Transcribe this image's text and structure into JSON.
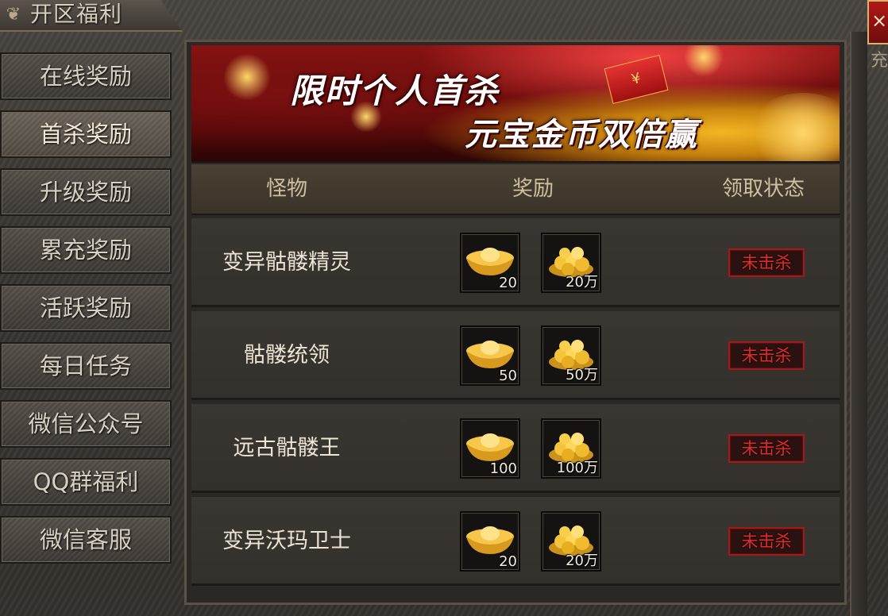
{
  "window": {
    "title": "开区福利",
    "close_label": "×",
    "right_edge_text": "充"
  },
  "sidebar": {
    "items": [
      {
        "label": "在线奖励",
        "active": false
      },
      {
        "label": "首杀奖励",
        "active": true
      },
      {
        "label": "升级奖励",
        "active": false
      },
      {
        "label": "累充奖励",
        "active": false
      },
      {
        "label": "活跃奖励",
        "active": false
      },
      {
        "label": "每日任务",
        "active": false
      },
      {
        "label": "微信公众号",
        "active": false
      },
      {
        "label": "QQ群福利",
        "active": false
      },
      {
        "label": "微信客服",
        "active": false
      }
    ]
  },
  "banner": {
    "line1": "限时个人首杀",
    "line2": "元宝金币双倍赢",
    "redpacket_symbol": "¥"
  },
  "table": {
    "headers": {
      "monster": "怪物",
      "reward": "奖励",
      "status": "领取状态"
    },
    "rows": [
      {
        "monster": "变异骷髅精灵",
        "ingot_qty": "20",
        "gold_qty": "20万",
        "status": "未击杀"
      },
      {
        "monster": "骷髅统领",
        "ingot_qty": "50",
        "gold_qty": "50万",
        "status": "未击杀"
      },
      {
        "monster": "远古骷髅王",
        "ingot_qty": "100",
        "gold_qty": "100万",
        "status": "未击杀"
      },
      {
        "monster": "变异沃玛卫士",
        "ingot_qty": "20",
        "gold_qty": "20万",
        "status": "未击杀"
      }
    ]
  },
  "icons": {
    "reward_1": "gold-ingot-icon",
    "reward_2": "gold-coins-icon"
  },
  "colors": {
    "status_text": "#e22a2a",
    "banner_red": "#8d1414",
    "gold": "#f2b623"
  }
}
